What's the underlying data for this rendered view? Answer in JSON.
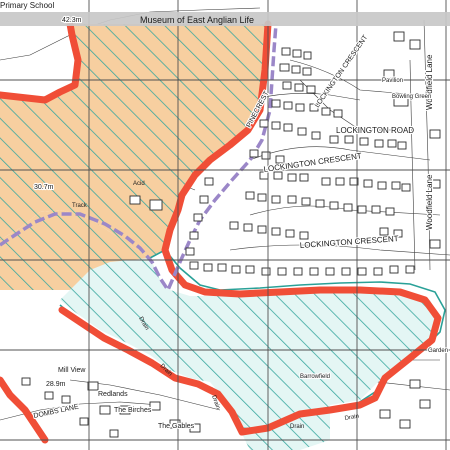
{
  "map": {
    "banner_label": "Museum of East Anglian Life",
    "colors": {
      "paper": "#ffffff",
      "linework": "#3c3c3c",
      "grid": "#505050",
      "banner": "#c8c8c8",
      "tan_fill": "#f7cfa0",
      "green_hatch": "#3aa8a0",
      "cyan_fill": "#e4f6f4",
      "boundary_red": "#f04e37",
      "boundary_teal": "#2aa198",
      "route_purple": "#9b87c8"
    },
    "labels": {
      "primary_school": "Primary School",
      "spot_height_top": "42.3m",
      "spot_height_left": "30.7m",
      "spot_height_bottom": "28.9m",
      "pinecrest": "PINECREST",
      "lockington_road": "LOCKINGTON ROAD",
      "lockington_crescent": "LOCKINGTON CRESCENT",
      "lockington_crescent_upper": "LOCKINGTON CRESCENT",
      "woodfield_lane": "Woodfield Lane",
      "bowling_green": "Bowling Green",
      "pavilion": "Pavilion",
      "drain_1": "Drain",
      "drain_2": "Drain",
      "drain_3": "Drain",
      "drain_4": "Drain",
      "drain_5": "Drain",
      "mill_view": "Mill View",
      "redlands": "Redlands",
      "the_birches": "The Birches",
      "the_gables": "The Gables",
      "dombs_lane": "DOMBS LANE",
      "garden": "Garden",
      "barrow_field": "Barrowfield",
      "acid": "Acid",
      "track": "Track"
    }
  }
}
